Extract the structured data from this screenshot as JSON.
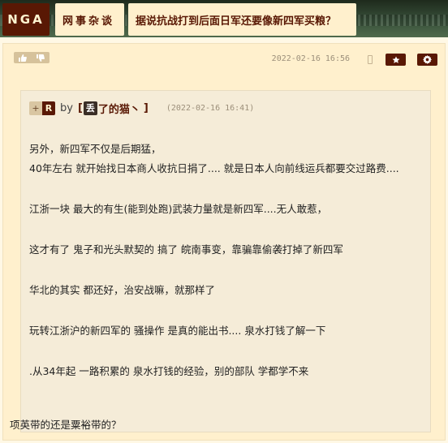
{
  "header": {
    "logo_text": "NGA",
    "forum_name": "网事杂谈",
    "topic_title": "据说抗战打到后面日军还要像新四军买粮？"
  },
  "post": {
    "date": "2022-02-16 16:56",
    "icons": {
      "like": "thumb-up-icon",
      "dislike": "thumb-down-icon",
      "device": "phone-icon",
      "favorite": "star-icon",
      "settings": "gear-icon"
    },
    "quote": {
      "plus_label": "+",
      "r_label": "R",
      "by_label": "by",
      "author_prefix": "[",
      "author_avatar_char": "丢",
      "author_rest": "了的猫丶",
      "author_suffix": "]",
      "timestamp": "(2022-02-16 16:41)",
      "lines": [
        "另外，新四军不仅是后期猛，",
        "40年左右 就开始找日本商人收抗日捐了.... 就是日本人向前线运兵都要交过路费....",
        "江浙一块 最大的有生(能到处跑)武装力量就是新四军....无人敢惹，",
        "这才有了 鬼子和光头默契的 搞了 皖南事变，靠骗靠偷袭打掉了新四军",
        "华北的其实 都还好，治安战嘛，就那样了",
        "玩转江浙沪的新四军的 骚操作 是真的能出书.... 泉水打钱了解一下",
        ".从34年起 一路积累的 泉水打钱的经验，别的部队 学都学不来"
      ]
    },
    "reply": "项英带的还是粟裕带的？"
  },
  "colors": {
    "brand": "#591804",
    "page_bg": "#fff8e5",
    "card_bg": "#fff0cd",
    "quote_bg": "#f5ecd8"
  }
}
